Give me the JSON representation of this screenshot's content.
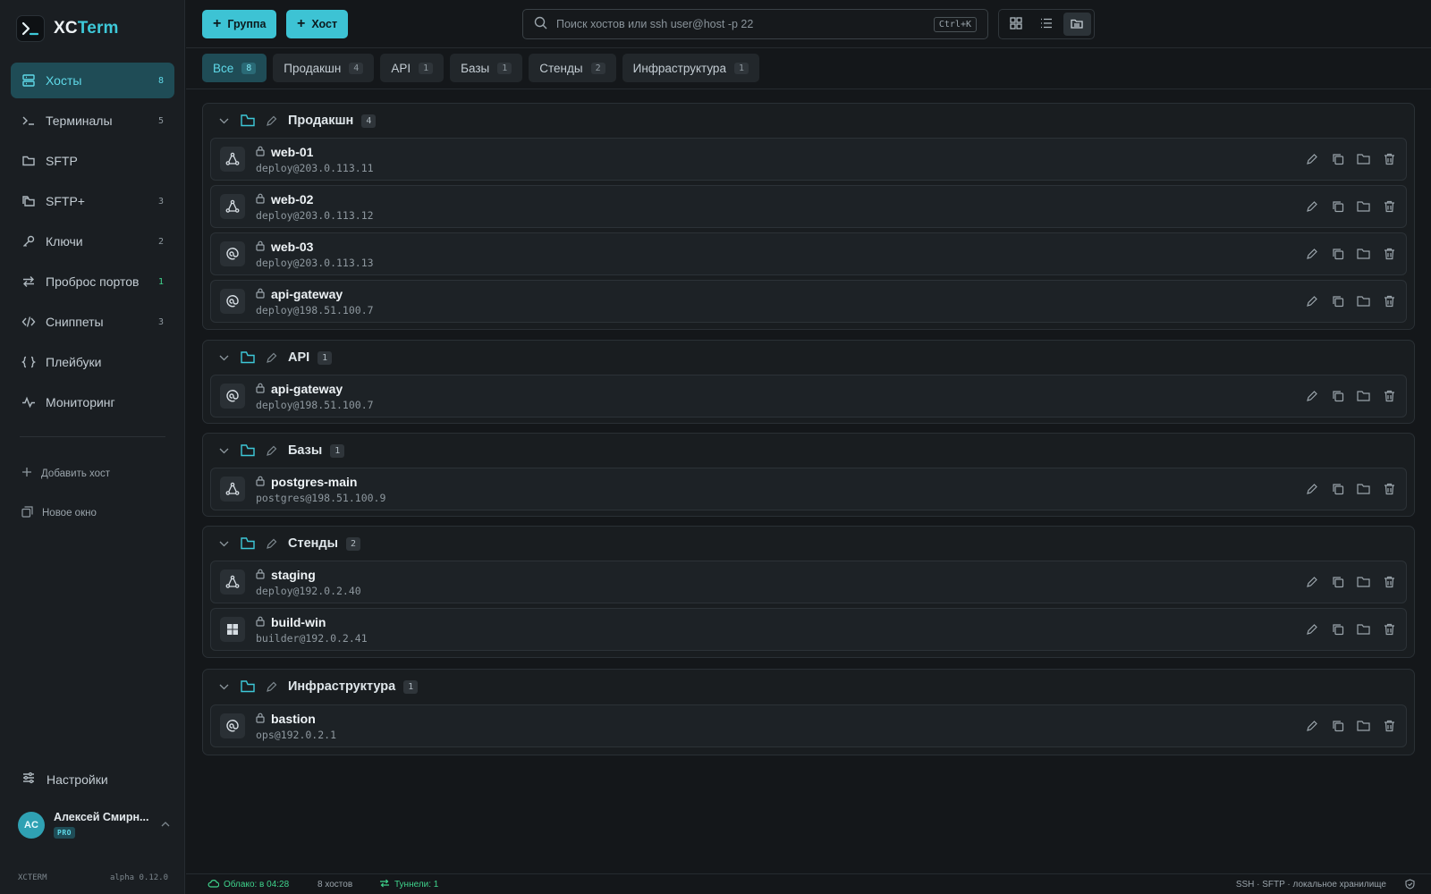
{
  "app": {
    "name_main": "XC",
    "name_accent": "Term"
  },
  "colors": {
    "accent": "#3dc3d4",
    "accent_bg": "#1f4c56",
    "green": "#3fd38c",
    "background": "#14171a"
  },
  "sidebar": {
    "items": [
      {
        "label": "Хосты",
        "count": "8",
        "icon": "server-icon",
        "active": true
      },
      {
        "label": "Терминалы",
        "count": "5",
        "icon": "terminal-icon"
      },
      {
        "label": "SFTP",
        "count": "",
        "icon": "folder-icon"
      },
      {
        "label": "SFTP+",
        "count": "3",
        "icon": "folders-icon"
      },
      {
        "label": "Ключи",
        "count": "2",
        "icon": "key-icon"
      },
      {
        "label": "Проброс портов",
        "count": "1",
        "icon": "arrows-icon"
      },
      {
        "label": "Сниппеты",
        "count": "3",
        "icon": "code-icon"
      },
      {
        "label": "Плейбуки",
        "count": "",
        "icon": "braces-icon"
      },
      {
        "label": "Мониторинг",
        "count": "",
        "icon": "pulse-icon"
      }
    ],
    "add_host": "Добавить хост",
    "new_window": "Новое окно",
    "settings": "Настройки",
    "user": {
      "initials": "AC",
      "name": "Алексей Смирн...",
      "plan": "PRO"
    },
    "footer_left": "XCTERM",
    "footer_right": "alpha 0.12.0"
  },
  "toolbar": {
    "group_button": "Группа",
    "host_button": "Хост",
    "search_placeholder": "Поиск хостов или ssh user@host -p 22",
    "search_shortcut": "Ctrl+K"
  },
  "tabs": [
    {
      "label": "Все",
      "count": "8",
      "active": true
    },
    {
      "label": "Продакшн",
      "count": "4"
    },
    {
      "label": "API",
      "count": "1"
    },
    {
      "label": "Базы",
      "count": "1"
    },
    {
      "label": "Стенды",
      "count": "2"
    },
    {
      "label": "Инфраструктура",
      "count": "1"
    }
  ],
  "groups": [
    {
      "title": "Продакшн",
      "count": "4",
      "hosts": [
        {
          "name": "web-01",
          "address": "deploy@203.0.113.11",
          "os": "linux"
        },
        {
          "name": "web-02",
          "address": "deploy@203.0.113.12",
          "os": "linux"
        },
        {
          "name": "web-03",
          "address": "deploy@203.0.113.13",
          "os": "debian"
        },
        {
          "name": "api-gateway",
          "address": "deploy@198.51.100.7",
          "os": "debian"
        }
      ]
    },
    {
      "title": "API",
      "count": "1",
      "hosts": [
        {
          "name": "api-gateway",
          "address": "deploy@198.51.100.7",
          "os": "debian"
        }
      ]
    },
    {
      "title": "Базы",
      "count": "1",
      "hosts": [
        {
          "name": "postgres-main",
          "address": "postgres@198.51.100.9",
          "os": "linux"
        }
      ]
    },
    {
      "title": "Стенды",
      "count": "2",
      "hosts": [
        {
          "name": "staging",
          "address": "deploy@192.0.2.40",
          "os": "linux"
        },
        {
          "name": "build-win",
          "address": "builder@192.0.2.41",
          "os": "windows"
        }
      ]
    },
    {
      "title": "Инфраструктура",
      "count": "1",
      "hosts": [
        {
          "name": "bastion",
          "address": "ops@192.0.2.1",
          "os": "debian"
        }
      ]
    }
  ],
  "statusbar": {
    "cloud": "Облако: в 04:28",
    "hosts": "8 хостов",
    "tunnels": "Туннели: 1",
    "storage": "SSH · SFTP · локальное хранилище"
  }
}
